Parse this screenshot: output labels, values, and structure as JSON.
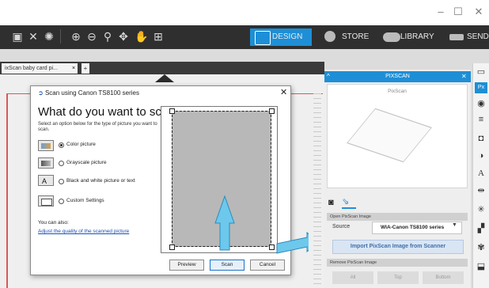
{
  "window": {
    "minimize": "–",
    "maximize": "☐",
    "close": "✕"
  },
  "toolbar": {
    "tabs": {
      "design": "DESIGN",
      "store": "STORE",
      "library": "LIBRARY",
      "send": "SEND"
    }
  },
  "document": {
    "tab_label": "ixScan baby card pi...",
    "tab_close": "×",
    "tab_add": "+"
  },
  "dialog": {
    "title": "Scan using Canon TS8100 series",
    "close": "✕",
    "heading": "What do you want to scan?",
    "subtitle": "Select an option below for the type of picture you want to scan.",
    "options": [
      {
        "label": "Color picture",
        "selected": true
      },
      {
        "label": "Grayscale picture",
        "selected": false
      },
      {
        "label": "Black and white picture or text",
        "selected": false
      },
      {
        "label": "Custom Settings",
        "selected": false
      }
    ],
    "also_label": "You can also:",
    "also_link": "Adjust the quality of the scanned picture",
    "buttons": {
      "preview": "Preview",
      "scan": "Scan",
      "cancel": "Cancel"
    }
  },
  "pixscan_panel": {
    "title": "PIXSCAN",
    "close": "✕",
    "collapse": "^",
    "preview_label": "PixScan",
    "open_section": "Open PixScan Image",
    "source_label": "Source",
    "source_value": "WIA-Canon TS8100 series",
    "import_button": "Import PixScan Image from Scanner",
    "remove_section": "Remove PixScan Image",
    "remove_buttons": [
      "All",
      "Top",
      "Bottom"
    ]
  },
  "colors": {
    "accent": "#1e8fd6",
    "toolbar_bg": "#2f2f2f",
    "arrow": "#5bc0e8"
  }
}
